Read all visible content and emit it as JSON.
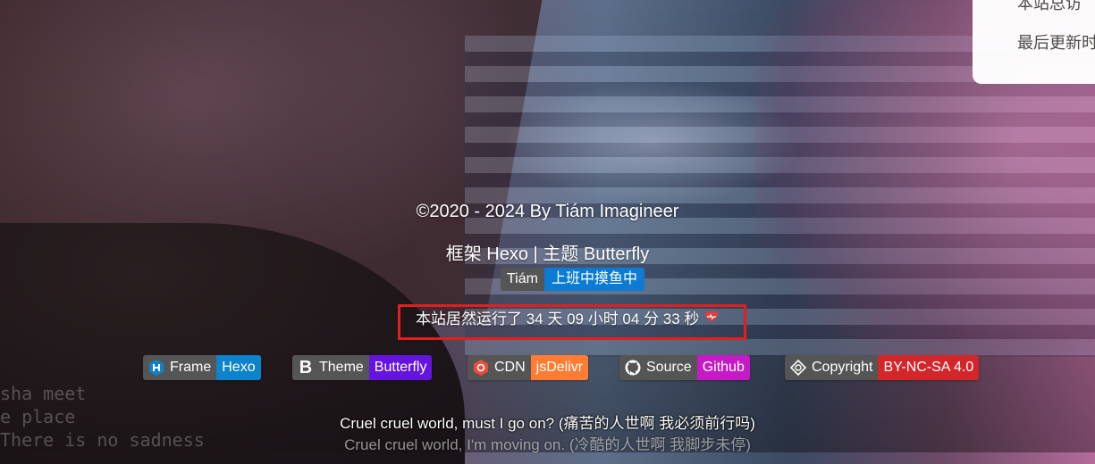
{
  "info_card": {
    "row1": "本站总访",
    "row2": "最后更新时"
  },
  "background_text": [
    "sha  meet",
    "e place",
    "There is no sadness"
  ],
  "footer": {
    "copyright": "©2020 - 2024 By Tiám Imagineer",
    "framework_label": "框架 Hexo | 主题 Butterfly",
    "slogan": {
      "left": "Tiám",
      "right": "上班中摸鱼中"
    },
    "runtime": "本站居然运行了 34 天 09 小时 04 分 33 秒",
    "badges": [
      {
        "left": "Frame",
        "right": "Hexo",
        "icon": "hexo-icon",
        "color": "#0e83cd"
      },
      {
        "left": "Theme",
        "right": "Butterfly",
        "icon": "butterfly-b-icon",
        "color": "#6513df"
      },
      {
        "left": "CDN",
        "right": "jsDelivr",
        "icon": "jsdelivr-icon",
        "color": "#ff7c32"
      },
      {
        "left": "Source",
        "right": "Github",
        "icon": "github-icon",
        "color": "#c61ac7"
      },
      {
        "left": "Copyright",
        "right": "BY-NC-SA 4.0",
        "icon": "creative-commons-icon",
        "color": "#d2262a"
      }
    ],
    "lyrics_current": "Cruel cruel world, must I go on? (痛苦的人世啊 我必须前行吗)",
    "lyrics_next": "Cruel cruel world, I'm moving on. (冷酷的人世啊 我脚步未停)"
  },
  "colors": {
    "highlight_box": "#e11f1f",
    "heart": "#e83a3a"
  }
}
